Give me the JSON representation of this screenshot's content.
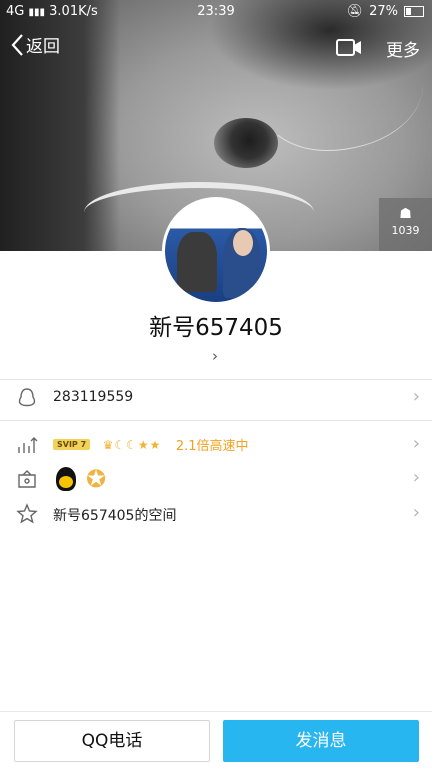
{
  "status_bar": {
    "network": "4G",
    "speed": "3.01K/s",
    "time": "23:39",
    "battery": "27%"
  },
  "header": {
    "back_label": "返回",
    "more_label": "更多"
  },
  "cover": {
    "view_count": "1039"
  },
  "profile": {
    "name": "新号657405"
  },
  "info": {
    "qq_number": "283119559",
    "vip_badge": "SVIP 7",
    "speed_text": "2.1倍高速中",
    "space_text": "新号657405的空间"
  },
  "bottom": {
    "call_label": "QQ电话",
    "message_label": "发消息"
  },
  "colors": {
    "accent": "#28b6f0",
    "vip_orange": "#f2a221"
  }
}
